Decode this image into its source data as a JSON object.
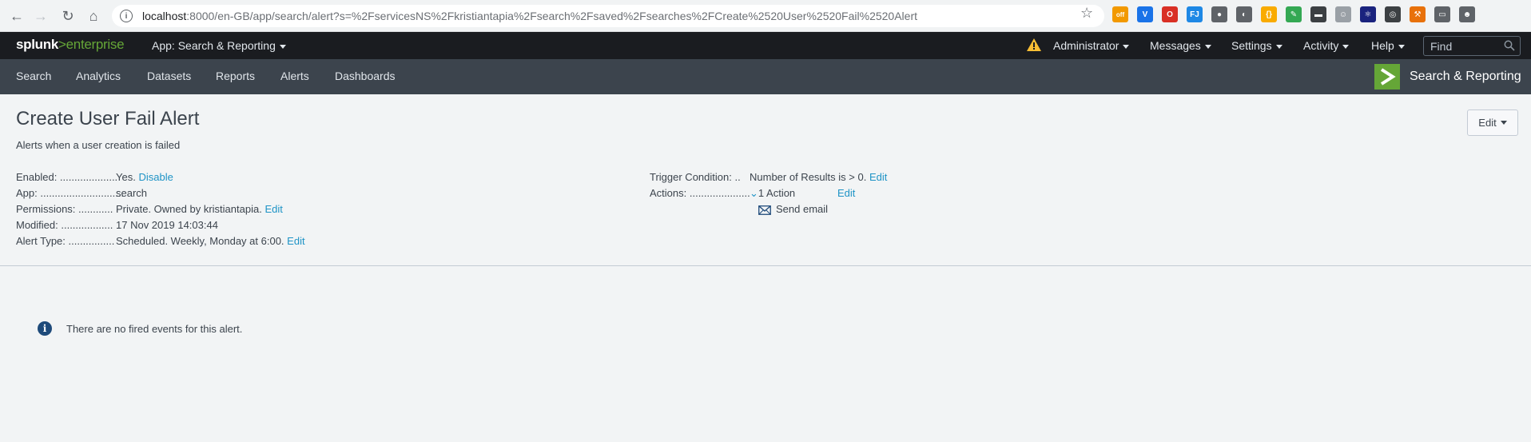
{
  "browser": {
    "url_host": "localhost",
    "url_path": ":8000/en-GB/app/search/alert?s=%2FservicesNS%2Fkristiantapia%2Fsearch%2Fsaved%2Fsearches%2FCreate%2520User%2520Fail%2520Alert",
    "extensions": [
      "off",
      "V",
      "O",
      "FJ",
      "●",
      "◐",
      "{}",
      "✎",
      "▬",
      "☺",
      "⚛",
      "◎",
      "⚒",
      "▭",
      "☻"
    ]
  },
  "topbar": {
    "logo_main": "splunk",
    "logo_gt": ">",
    "logo_product": "enterprise",
    "app_menu": "App: Search & Reporting",
    "administrator": "Administrator",
    "messages": "Messages",
    "settings": "Settings",
    "activity": "Activity",
    "help": "Help",
    "find_placeholder": "Find"
  },
  "appbar": {
    "items": [
      "Search",
      "Analytics",
      "Datasets",
      "Reports",
      "Alerts",
      "Dashboards"
    ],
    "app_title": "Search & Reporting",
    "accent": "#65a637"
  },
  "alert": {
    "title": "Create User Fail Alert",
    "description": "Alerts when a user creation is failed",
    "edit_button": "Edit"
  },
  "details_left": [
    {
      "label": "Enabled: ....................",
      "value": "Yes.",
      "link": "Disable"
    },
    {
      "label": "App: .............................",
      "value": "search",
      "link": ""
    },
    {
      "label": "Permissions: ............",
      "value": "Private. Owned by kristiantapia.",
      "link": "Edit"
    },
    {
      "label": "Modified: ..................",
      "value": "17 Nov 2019 14:03:44",
      "link": ""
    },
    {
      "label": "Alert Type: ................",
      "value": "Scheduled. Weekly, Monday at 6:00.",
      "link": "Edit"
    }
  ],
  "details_right": {
    "trigger_label": "Trigger Condition: ..",
    "trigger_value": "Number of Results is > 0.",
    "trigger_link": "Edit",
    "actions_label": "Actions: .....................",
    "actions_value": "1 Action",
    "actions_link": "Edit",
    "action_item": "Send email"
  },
  "events": {
    "message": "There are no fired events for this alert."
  }
}
